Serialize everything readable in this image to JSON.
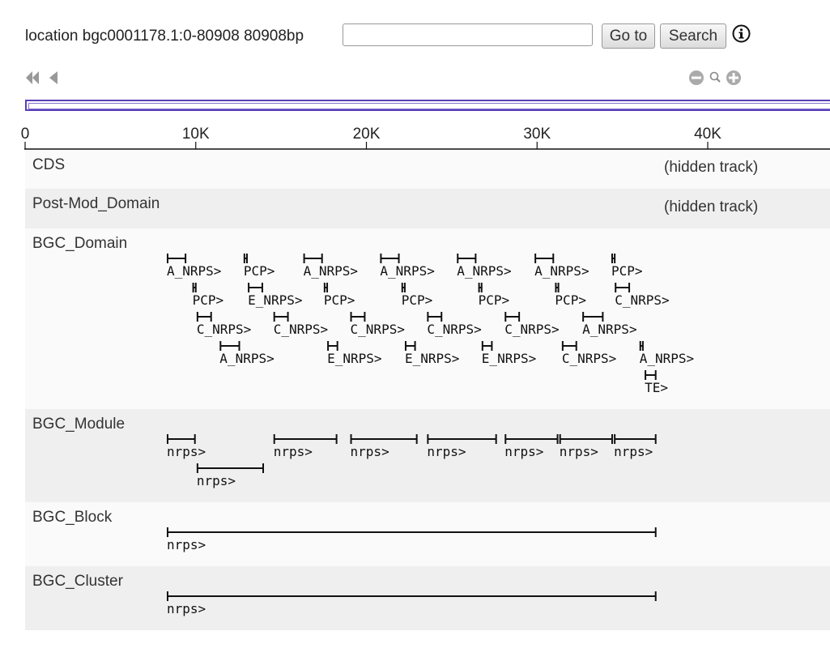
{
  "header": {
    "location_label": "location bgc0001178.1:0-80908 80908bp",
    "search_value": "",
    "goto_label": "Go to",
    "search_label": "Search"
  },
  "icons": {
    "info": "info-icon",
    "nav_fast_back": "double-left-arrow-icon",
    "nav_back": "left-arrow-icon",
    "zoom_out": "zoom-out-icon",
    "zoom_reset": "magnifier-icon",
    "zoom_in": "zoom-in-icon"
  },
  "ruler": {
    "ticks": [
      {
        "pos": 0,
        "label": "0"
      },
      {
        "pos": 10000,
        "label": "10K"
      },
      {
        "pos": 20000,
        "label": "20K"
      },
      {
        "pos": 30000,
        "label": "30K"
      },
      {
        "pos": 40000,
        "label": "40K"
      }
    ]
  },
  "tracks": {
    "cds": {
      "label": "CDS",
      "note": "(hidden track)"
    },
    "postmod": {
      "label": "Post-Mod_Domain",
      "note": "(hidden track)"
    },
    "domain": {
      "label": "BGC_Domain",
      "features": [
        {
          "start": 8350,
          "end": 9400,
          "row": 0,
          "name": "A_NRPS>"
        },
        {
          "start": 12850,
          "end": 13000,
          "row": 0,
          "name": "PCP>"
        },
        {
          "start": 16350,
          "end": 17400,
          "row": 0,
          "name": "A_NRPS>"
        },
        {
          "start": 20850,
          "end": 21900,
          "row": 0,
          "name": "A_NRPS>"
        },
        {
          "start": 25350,
          "end": 26400,
          "row": 0,
          "name": "A_NRPS>"
        },
        {
          "start": 29900,
          "end": 30950,
          "row": 0,
          "name": "A_NRPS>"
        },
        {
          "start": 34400,
          "end": 34550,
          "row": 0,
          "name": "PCP>"
        },
        {
          "start": 9850,
          "end": 10000,
          "row": 1,
          "name": "PCP>"
        },
        {
          "start": 13100,
          "end": 13900,
          "row": 1,
          "name": "E_NRPS>"
        },
        {
          "start": 17550,
          "end": 17700,
          "row": 1,
          "name": "PCP>"
        },
        {
          "start": 22100,
          "end": 22250,
          "row": 1,
          "name": "PCP>"
        },
        {
          "start": 26600,
          "end": 26750,
          "row": 1,
          "name": "PCP>"
        },
        {
          "start": 31100,
          "end": 31250,
          "row": 1,
          "name": "PCP>"
        },
        {
          "start": 34600,
          "end": 35400,
          "row": 1,
          "name": "C_NRPS>"
        },
        {
          "start": 10100,
          "end": 10900,
          "row": 2,
          "name": "C_NRPS>"
        },
        {
          "start": 14600,
          "end": 15400,
          "row": 2,
          "name": "C_NRPS>"
        },
        {
          "start": 19100,
          "end": 19900,
          "row": 2,
          "name": "C_NRPS>"
        },
        {
          "start": 23600,
          "end": 24400,
          "row": 2,
          "name": "C_NRPS>"
        },
        {
          "start": 28150,
          "end": 28950,
          "row": 2,
          "name": "C_NRPS>"
        },
        {
          "start": 32700,
          "end": 33850,
          "row": 2,
          "name": "A_NRPS>"
        },
        {
          "start": 11450,
          "end": 12550,
          "row": 3,
          "name": "A_NRPS>"
        },
        {
          "start": 17750,
          "end": 18300,
          "row": 3,
          "name": "E_NRPS>"
        },
        {
          "start": 22300,
          "end": 22850,
          "row": 3,
          "name": "E_NRPS>"
        },
        {
          "start": 26800,
          "end": 27350,
          "row": 3,
          "name": "E_NRPS>"
        },
        {
          "start": 31500,
          "end": 32300,
          "row": 3,
          "name": "C_NRPS>"
        },
        {
          "start": 36050,
          "end": 36200,
          "row": 3,
          "name": "A_NRPS>"
        },
        {
          "start": 36350,
          "end": 36950,
          "row": 4,
          "name": "TE>"
        }
      ]
    },
    "module": {
      "label": "BGC_Module",
      "features": [
        {
          "start": 8350,
          "end": 9950,
          "row": 0,
          "name": "nrps>"
        },
        {
          "start": 14600,
          "end": 18250,
          "row": 0,
          "name": "nrps>"
        },
        {
          "start": 19100,
          "end": 22950,
          "row": 0,
          "name": "nrps>"
        },
        {
          "start": 23600,
          "end": 27600,
          "row": 0,
          "name": "nrps>"
        },
        {
          "start": 28150,
          "end": 31200,
          "row": 0,
          "name": "nrps>"
        },
        {
          "start": 31350,
          "end": 34400,
          "row": 0,
          "name": "nrps>"
        },
        {
          "start": 34550,
          "end": 36950,
          "row": 0,
          "name": "nrps>"
        },
        {
          "start": 10100,
          "end": 13950,
          "row": 1,
          "name": "nrps>"
        }
      ]
    },
    "block": {
      "label": "BGC_Block",
      "features": [
        {
          "start": 8350,
          "end": 36950,
          "row": 0,
          "name": "nrps>"
        }
      ]
    },
    "cluster": {
      "label": "BGC_Cluster",
      "features": [
        {
          "start": 8350,
          "end": 36950,
          "row": 0,
          "name": "nrps>"
        }
      ]
    }
  },
  "colors": {
    "overview_border": "#5a3fb8",
    "track_bg_light": "#fafafa",
    "track_bg_dark": "#efefef"
  }
}
